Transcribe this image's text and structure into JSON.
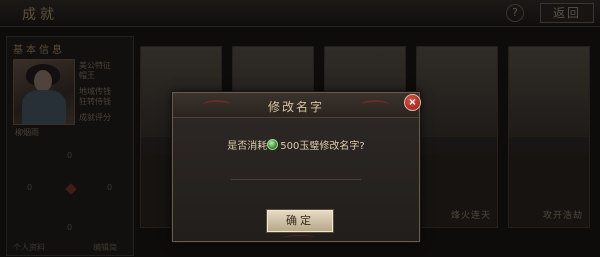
{
  "topbar": {
    "title": "成就",
    "help_label": "?",
    "back_label": "返回"
  },
  "sidebar": {
    "header": "基本信息",
    "player_name": "柳烟雨",
    "info": [
      "美公特征",
      "帽王",
      "地域传钱",
      "狂转侍钱",
      "成就评分"
    ],
    "stats": [
      "0",
      "0",
      "0",
      "0"
    ],
    "footer_left": "个人资料",
    "footer_right": "编辑简"
  },
  "cards": [
    {
      "label": ""
    },
    {
      "label": ""
    },
    {
      "label": ""
    },
    {
      "label": "烽火连天"
    },
    {
      "label": "攻开浩劫"
    }
  ],
  "dialog": {
    "title": "修改名字",
    "message_prefix": "是否消耗",
    "message_suffix": "500玉璧修改名字?",
    "currency_icon": "jade-coin-icon",
    "input_value": "",
    "confirm_label": "确定",
    "close_label": "×"
  },
  "colors": {
    "accent": "#d7c3a0",
    "close": "#c43b30",
    "currency": "#3a8f3a"
  }
}
